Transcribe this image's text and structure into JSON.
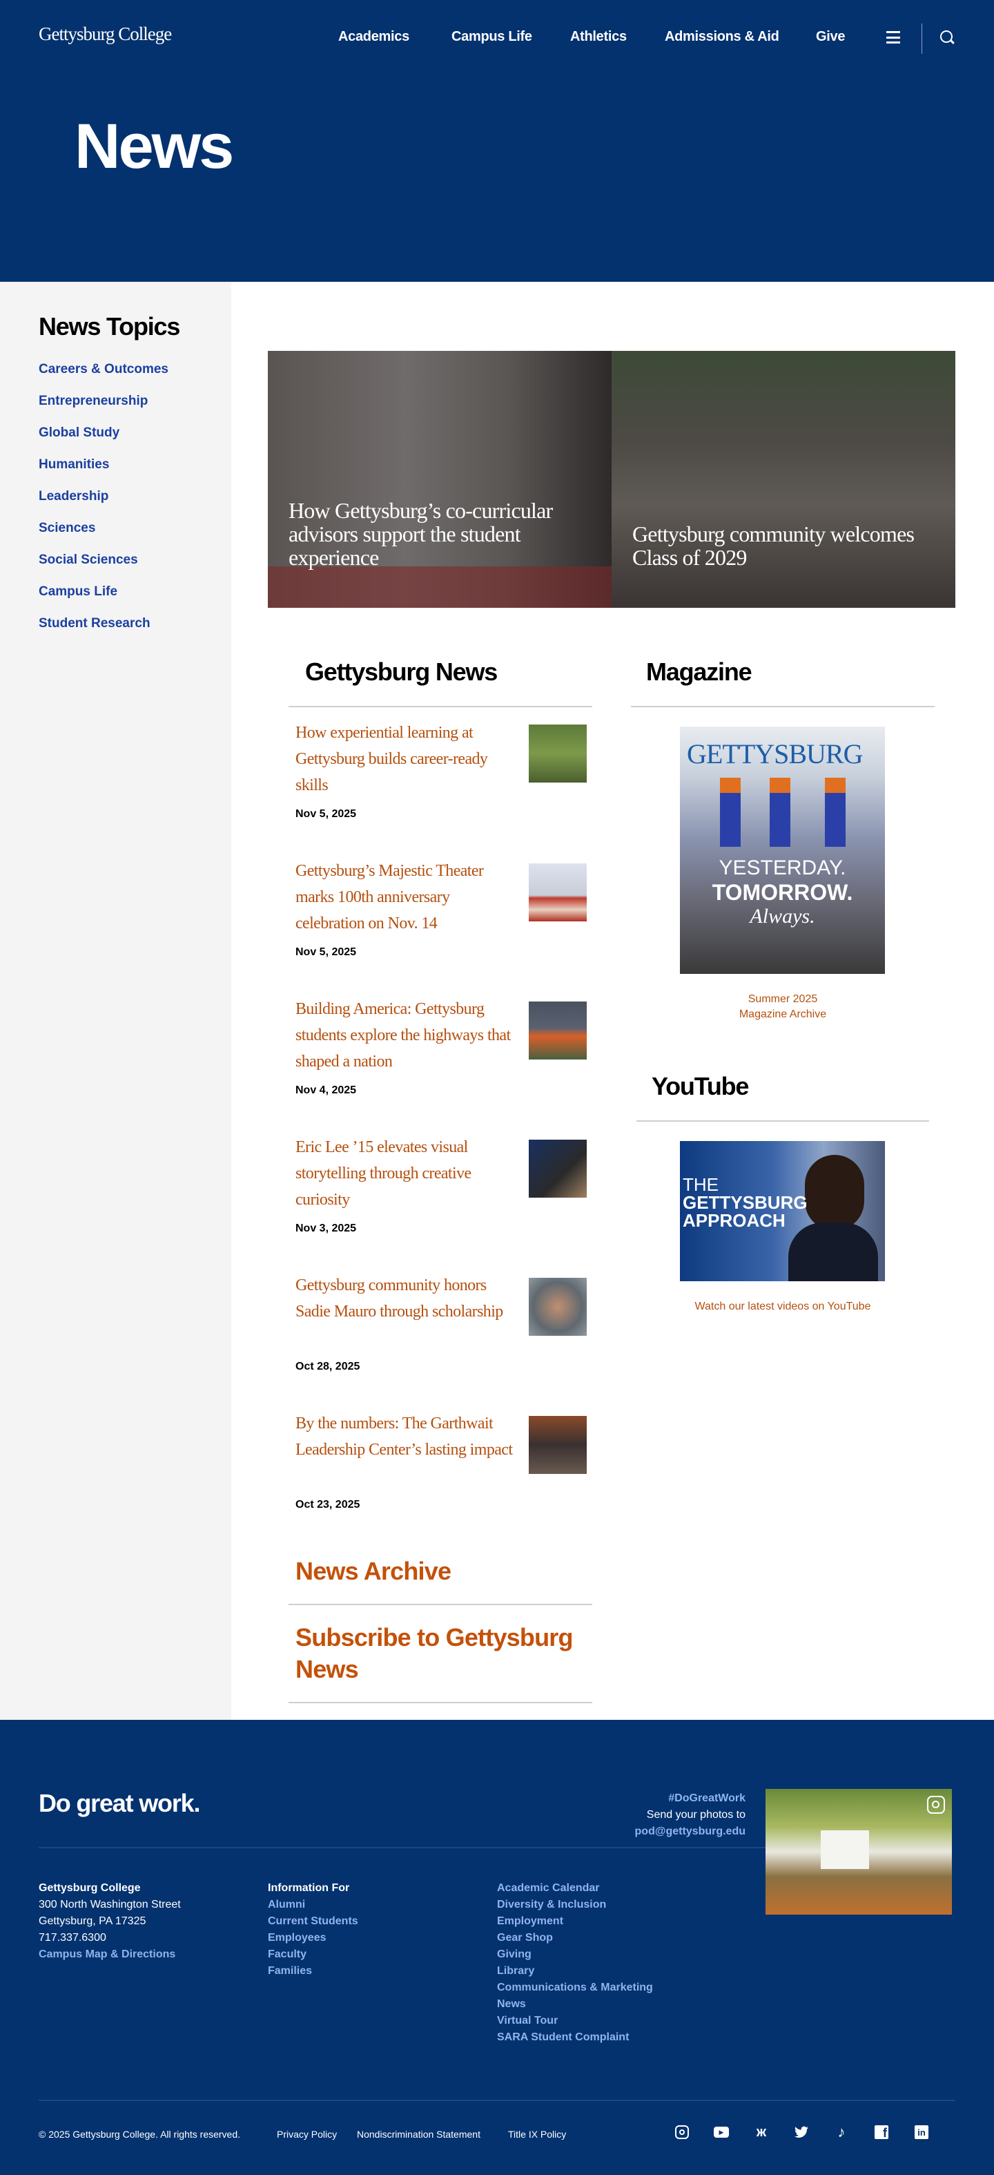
{
  "header": {
    "logo": "Gettysburg College",
    "nav": [
      "Academics",
      "Campus Life",
      "Athletics",
      "Admissions & Aid",
      "Give"
    ],
    "page_title": "News"
  },
  "sidebar": {
    "title": "News Topics",
    "items": [
      "Careers & Outcomes",
      "Entrepreneurship",
      "Global Study",
      "Humanities",
      "Leadership",
      "Sciences",
      "Social Sciences",
      "Campus Life",
      "Student Research"
    ]
  },
  "featured": [
    {
      "title": "How Gettysburg’s co-curricular advisors support the student experience"
    },
    {
      "title": "Gettysburg community welcomes Class of 2029"
    }
  ],
  "news": {
    "heading": "Gettysburg News",
    "items": [
      {
        "title": "How experiential learning at Gettysburg builds career-ready skills",
        "date": "Nov 5, 2025"
      },
      {
        "title": "Gettysburg’s Majestic Theater marks 100th anniversary celebration on Nov. 14",
        "date": "Nov 5, 2025"
      },
      {
        "title": "Building America: Gettysburg students explore the highways that shaped a nation",
        "date": "Nov 4, 2025"
      },
      {
        "title": "Eric Lee ’15 elevates visual storytelling through creative curiosity",
        "date": "Nov 3, 2025"
      },
      {
        "title": "Gettysburg community honors Sadie Mauro through scholarship",
        "date": "Oct 28, 2025"
      },
      {
        "title": "By the numbers: The Garthwait Leadership Center’s lasting impact",
        "date": "Oct 23, 2025"
      }
    ],
    "archive": "News Archive",
    "subscribe": "Subscribe to Gettysburg News"
  },
  "magazine": {
    "heading": "Magazine",
    "cover_title": "GETTYSBURG",
    "cover_line1": "YESTERDAY.",
    "cover_line2": "TOMORROW.",
    "cover_line3": "Always.",
    "issue": "Summer 2025",
    "archive": "Magazine Archive"
  },
  "youtube": {
    "heading": "YouTube",
    "thumb_line1": "THE",
    "thumb_line2": "GETTYSBURG",
    "thumb_line3": "APPROACH",
    "caption": "Watch our latest videos on YouTube"
  },
  "footer": {
    "tagline": "Do great work.",
    "hashtag": "#DoGreatWork",
    "send": "Send your photos to",
    "email": "pod@gettysburg.edu",
    "address": {
      "name": "Gettysburg College",
      "street": "300 North Washington Street",
      "city": "Gettysburg, PA 17325",
      "phone": "717.337.6300",
      "map": "Campus Map & Directions"
    },
    "info": {
      "title": "Information For",
      "items": [
        "Alumni",
        "Current Students",
        "Employees",
        "Faculty",
        "Families"
      ]
    },
    "links": [
      "Academic Calendar",
      "Diversity & Inclusion",
      "Employment",
      "Gear Shop",
      "Giving",
      "Library",
      "Communications & Marketing",
      "News",
      "Virtual Tour",
      "SARA Student Complaint"
    ],
    "copyright": "© 2025 Gettysburg College. All rights reserved.",
    "legal": [
      "Privacy Policy",
      "Nondiscrimination Statement",
      "Title IX Policy"
    ],
    "social": [
      "instagram-icon",
      "youtube-icon",
      "bluesky-icon",
      "twitter-icon",
      "tiktok-icon",
      "facebook-icon",
      "linkedin-icon"
    ]
  }
}
